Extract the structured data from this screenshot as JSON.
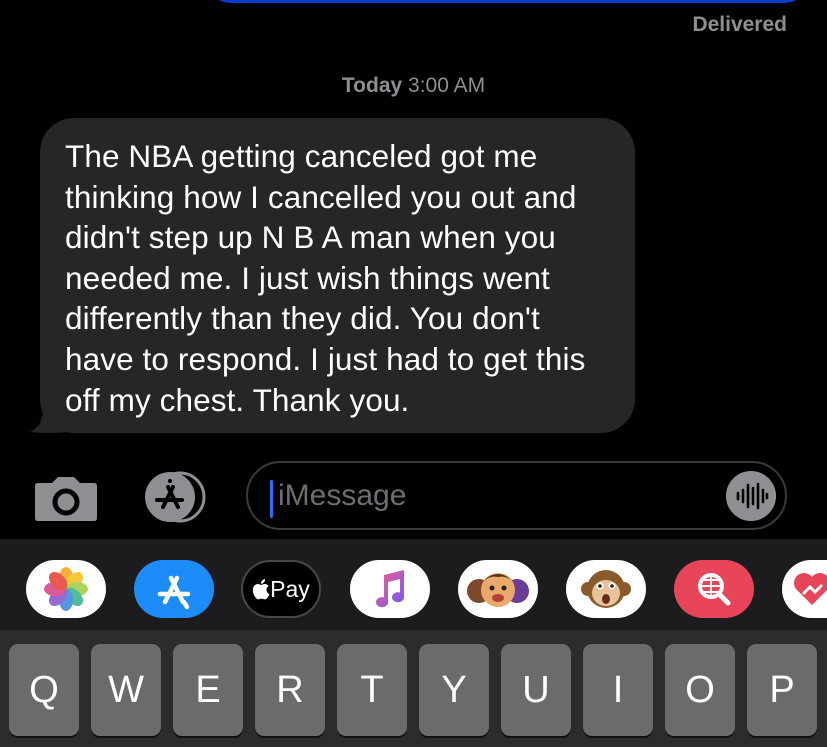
{
  "status": {
    "delivered": "Delivered"
  },
  "timestamp": {
    "day": "Today",
    "time": "3:00 AM"
  },
  "message": {
    "text": "The NBA getting canceled got me thinking how I cancelled you out and didn't step up N B A man when you needed me. I just wish things went differently than they did. You don't have to respond. I just had to get this off my chest. Thank you."
  },
  "input": {
    "placeholder": "iMessage"
  },
  "apps": {
    "applepay": "Pay",
    "icons": [
      "photos-icon",
      "app-store-icon",
      "apple-pay-icon",
      "music-icon",
      "memoji-icon",
      "animoji-icon",
      "search-images-icon",
      "digital-touch-icon"
    ]
  },
  "keyboard": {
    "row1": [
      "Q",
      "W",
      "E",
      "R",
      "T",
      "Y",
      "U",
      "I",
      "O",
      "P"
    ]
  },
  "colors": {
    "background": "#000000",
    "received_bubble": "#262628",
    "sent_bubble": "#0a3bcc",
    "caret": "#2f6cf7",
    "key": "#6b6b6e"
  }
}
